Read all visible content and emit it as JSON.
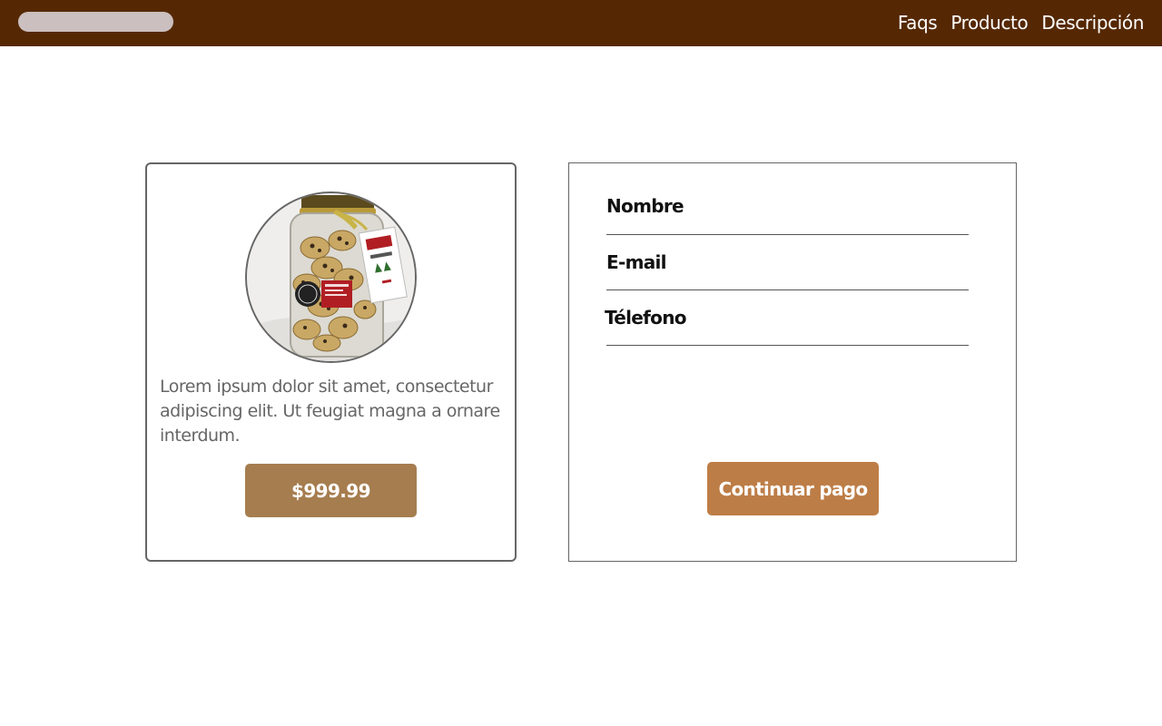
{
  "header": {
    "nav": [
      {
        "label": "Faqs"
      },
      {
        "label": "Producto"
      },
      {
        "label": "Descripción"
      }
    ]
  },
  "product": {
    "image_icon": "cookie-jar-image",
    "description": "Lorem ipsum dolor sit amet, consectetur adipiscing elit. Ut feugiat magna a ornare interdum.",
    "price": "$999.99"
  },
  "form": {
    "fields": [
      {
        "label": "Nombre",
        "value": ""
      },
      {
        "label": "E-mail",
        "value": ""
      },
      {
        "label": "Télefono",
        "value": ""
      }
    ],
    "submit_label": "Continuar pago"
  },
  "colors": {
    "header_bg": "#552803",
    "logo_pill": "#cbbfbf",
    "price_button": "#a67d4f",
    "pay_button": "#bd7d46"
  }
}
